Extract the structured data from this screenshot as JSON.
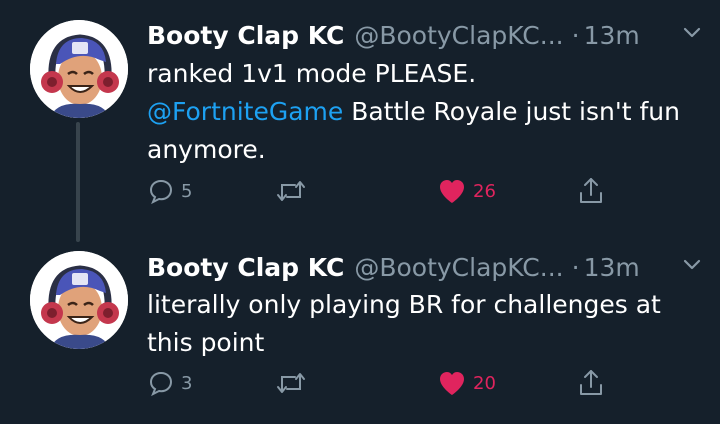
{
  "tweets": [
    {
      "display_name": "Booty Clap KC",
      "handle": "@BootyClapKC...",
      "dot": "·",
      "time": "13m",
      "text_line1": "ranked 1v1 mode PLEASE.",
      "mention": "@FortniteGame",
      "text_rest": " Battle Royale just isn't fun anymore.",
      "reply_count": "5",
      "retweet_count": "",
      "like_count": "26"
    },
    {
      "display_name": "Booty Clap KC",
      "handle": "@BootyClapKC...",
      "dot": "·",
      "time": "13m",
      "text": "literally only playing BR for challenges at this point",
      "reply_count": "3",
      "retweet_count": "",
      "like_count": "20"
    }
  ],
  "colors": {
    "background": "#15202b",
    "secondary_text": "#8899a6",
    "mention": "#1da1f2",
    "liked": "#e0245e",
    "thread_line": "#38444d"
  },
  "icons": {
    "reply": "reply-bubble-icon",
    "retweet": "retweet-icon",
    "like": "heart-filled-icon",
    "share": "share-icon",
    "menu": "chevron-down-icon"
  }
}
